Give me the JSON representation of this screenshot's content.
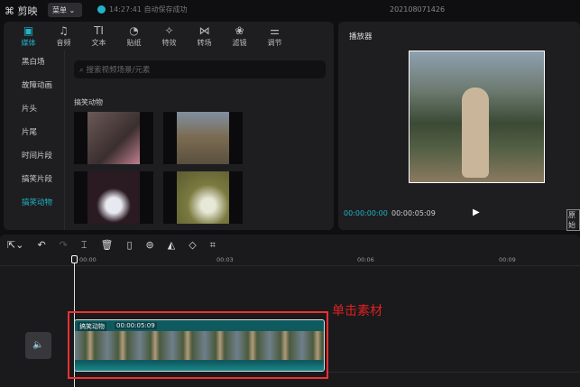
{
  "app": {
    "name": "剪映",
    "menu": "菜单",
    "save_status": "14:27:41 自动保存成功",
    "project": "202108071426"
  },
  "tabs": [
    {
      "icon": "▣",
      "label": "媒体"
    },
    {
      "icon": "♫",
      "label": "音频"
    },
    {
      "icon": "TI",
      "label": "文本"
    },
    {
      "icon": "◔",
      "label": "贴纸"
    },
    {
      "icon": "✧",
      "label": "特效"
    },
    {
      "icon": "⋈",
      "label": "转场"
    },
    {
      "icon": "❀",
      "label": "滤镜"
    },
    {
      "icon": "⚌",
      "label": "调节"
    }
  ],
  "sidebar": [
    "黑白场",
    "故障动画",
    "片头",
    "片尾",
    "时间片段",
    "搞笑片段",
    "搞笑动物"
  ],
  "search": {
    "placeholder": "搜索视频场景/元素"
  },
  "category": "搞笑动物",
  "player": {
    "title": "播放器",
    "current": "00:00:00:00",
    "total": "00:00:05:09",
    "ratio": "原始"
  },
  "ruler": [
    "00:00",
    "00:03",
    "00:06",
    "00:09"
  ],
  "clip": {
    "name": "搞笑动物",
    "duration": "00:00:05:09"
  },
  "annotation": "单击素材",
  "colors": {
    "accent": "#1fb5c8",
    "highlight": "#f03030"
  }
}
